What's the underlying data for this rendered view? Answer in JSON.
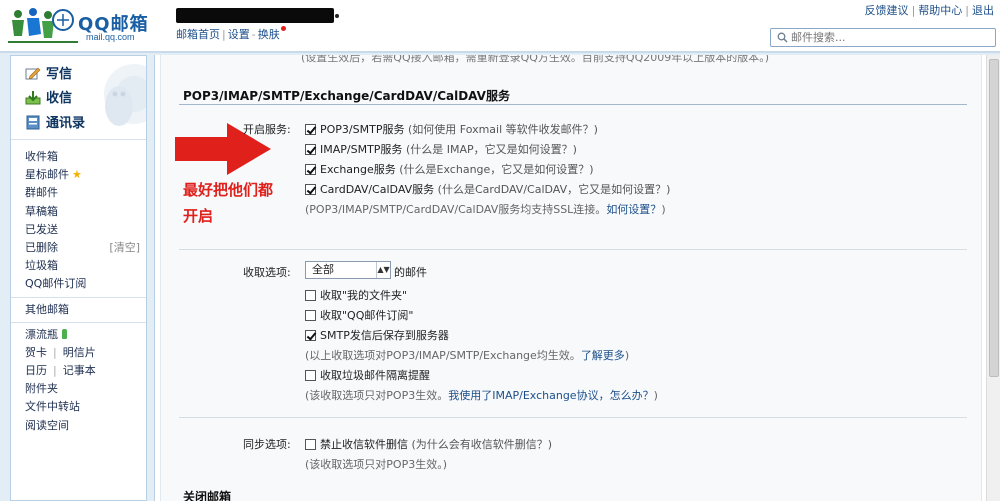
{
  "brand": {
    "logo_text": "QQ邮箱",
    "logo_sub": "mail.qq.com"
  },
  "header": {
    "links": [
      "邮箱首页",
      "设置",
      "换肤"
    ],
    "top_right": [
      "反馈建议",
      "帮助中心",
      "退出"
    ],
    "search_placeholder": "邮件搜索..."
  },
  "sidebar": {
    "quick": [
      "写信",
      "收信",
      "通讯录"
    ],
    "folders": [
      "收件箱",
      "星标邮件",
      "群邮件",
      "草稿箱",
      "已发送",
      "已删除",
      "垃圾箱",
      "QQ邮件订阅"
    ],
    "deleted_extra": "[清空]",
    "other": "其他邮箱",
    "apps_bottle": "漂流瓶",
    "apps_pair1": [
      "贺卡",
      "明信片"
    ],
    "apps_pair2": [
      "日历",
      "记事本"
    ],
    "apps_rest": [
      "附件夹",
      "文件中转站",
      "阅读空间"
    ]
  },
  "main": {
    "top_clip": "(设置生效后，若需QQ接入邮箱，需重新登录QQ方生效。目前支持QQ2009年以上版本的版本。)",
    "section_title": "POP3/IMAP/SMTP/Exchange/CardDAV/CalDAV服务",
    "service_label": "开启服务:",
    "services": [
      {
        "name": "POP3/SMTP服务",
        "hint": "(如何使用 Foxmail 等软件收发邮件？)",
        "checked": true
      },
      {
        "name": "IMAP/SMTP服务",
        "hint": "(什么是 IMAP，它又是如何设置？)",
        "checked": true
      },
      {
        "name": "Exchange服务",
        "hint": "(什么是Exchange，它又是如何设置？)",
        "checked": true
      },
      {
        "name": "CardDAV/CalDAV服务",
        "hint": "(什么是CardDAV/CalDAV，它又是如何设置？)",
        "checked": true
      }
    ],
    "ssl_note": "(POP3/IMAP/SMTP/CardDAV/CalDAV服务均支持SSL连接。",
    "ssl_link": "如何设置？",
    "ssl_close": ")",
    "annotation_line1": "最好把他们都",
    "annotation_line2": "开启",
    "receive_label": "收取选项:",
    "receive_select": "全部",
    "receive_suffix": "的邮件",
    "receive_options": [
      {
        "label": "收取\"我的文件夹\"",
        "checked": false
      },
      {
        "label": "收取\"QQ邮件订阅\"",
        "checked": false
      },
      {
        "label": "SMTP发信后保存到服务器",
        "checked": true
      }
    ],
    "receive_note": "(以上收取选项对POP3/IMAP/SMTP/Exchange均生效。",
    "receive_note_link": "了解更多",
    "receive_note_close": ")",
    "spam_option": {
      "label": "收取垃圾邮件隔离提醒",
      "checked": false
    },
    "spam_note": "(该收取选项只对POP3生效。",
    "spam_note_link": "我使用了IMAP/Exchange协议，怎么办？",
    "spam_note_close": ")",
    "sync_label": "同步选项:",
    "sync_option": {
      "label": "禁止收信软件删信",
      "checked": false
    },
    "sync_hint": "(为什么会有收信软件删信？)",
    "sync_note": "(该收取选项只对POP3生效。)",
    "close_title": "关闭邮箱"
  },
  "colors": {
    "accent_red": "#e0201b",
    "link_blue": "#1d4f8a",
    "page_bg": "#e3edf5"
  }
}
